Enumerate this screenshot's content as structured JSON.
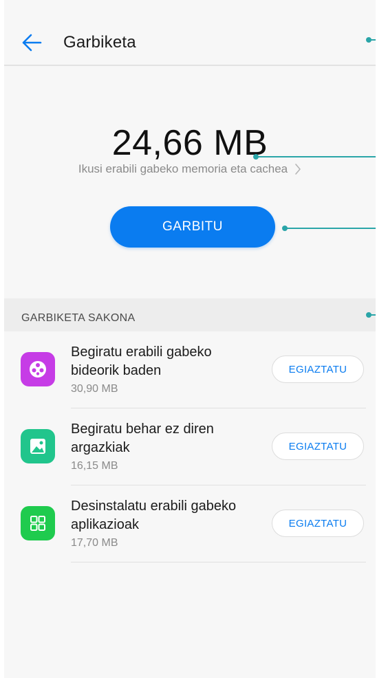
{
  "header": {
    "title": "Garbiketa",
    "back_icon": "back-arrow-icon"
  },
  "summary": {
    "size": "24,66 MB",
    "detail_link": "Ikusi erabili gabeko memoria eta cachea",
    "clean_button": "GARBITU"
  },
  "deep_clean": {
    "section_title": "GARBIKETA SAKONA",
    "items": [
      {
        "title": "Begiratu erabili gabeko bideorik baden",
        "size": "30,90 MB",
        "button": "EGIAZTATU",
        "icon": "video-icon",
        "icon_color": "#c63ce6"
      },
      {
        "title": "Begiratu behar ez diren argazkiak",
        "size": "16,15 MB",
        "button": "EGIAZTATU",
        "icon": "image-icon",
        "icon_color": "#21c58c"
      },
      {
        "title": "Desinstalatu erabili gabeko aplikazioak",
        "size": "17,70 MB",
        "button": "EGIAZTATU",
        "icon": "apps-icon",
        "icon_color": "#1fcb4e"
      }
    ]
  },
  "colors": {
    "accent": "#0a7cf0",
    "callout": "#2aa5a8"
  }
}
